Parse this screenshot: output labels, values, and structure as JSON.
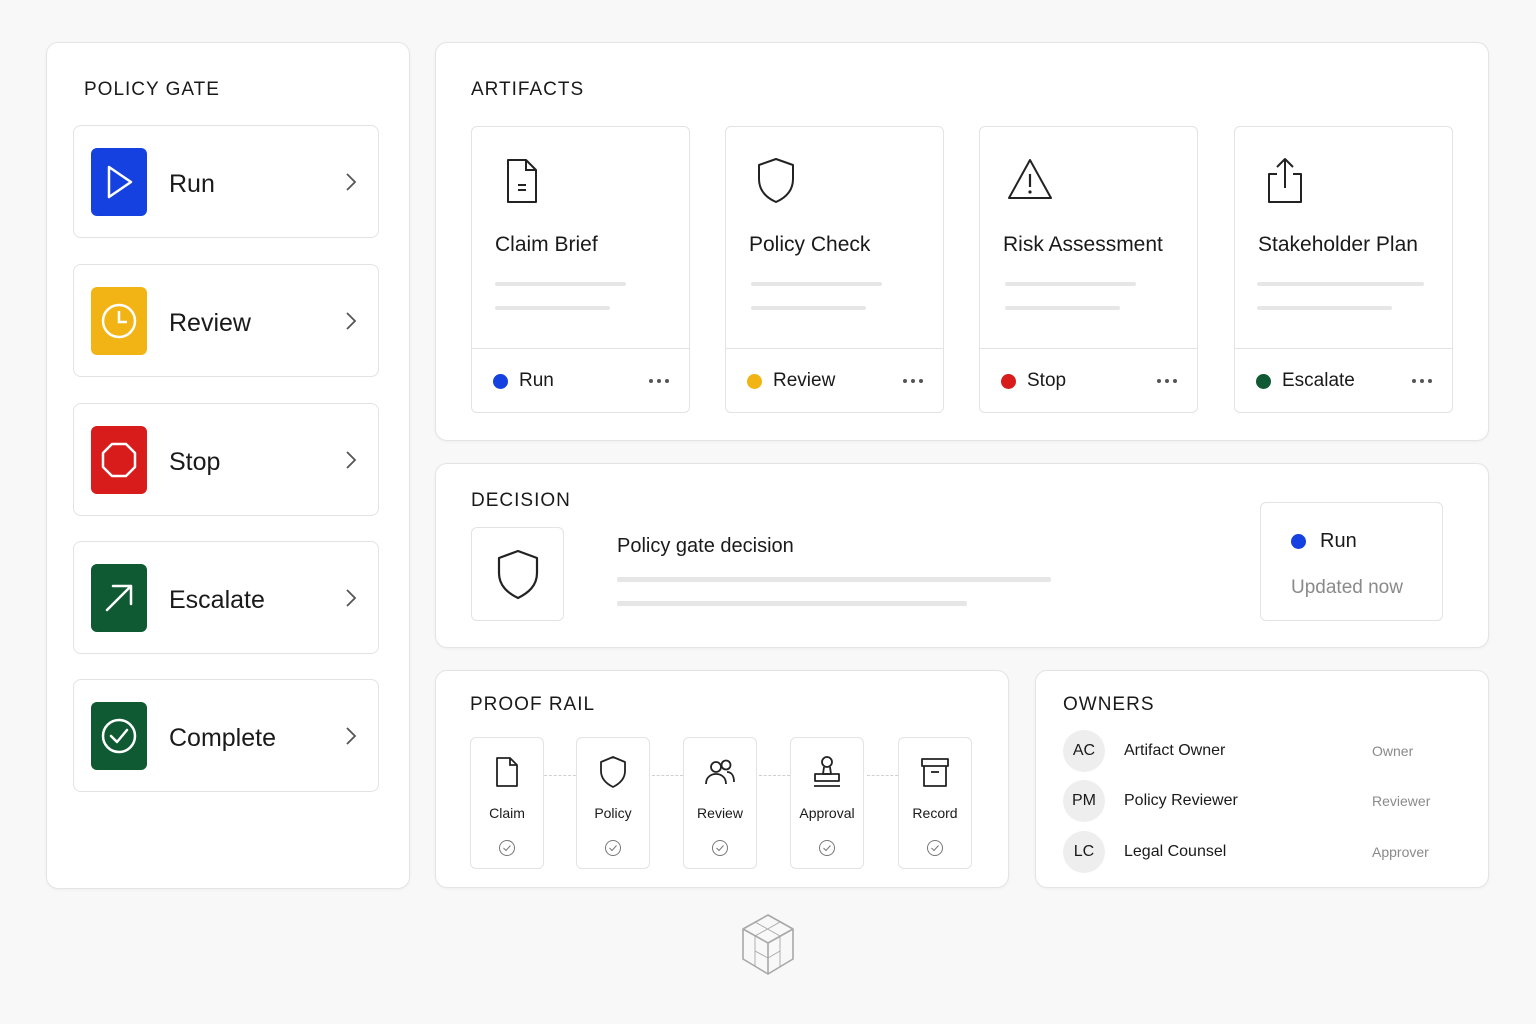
{
  "colors": {
    "run": "#1441e0",
    "review": "#f2b414",
    "stop": "#d81b1b",
    "escalate": "#0f5a32",
    "complete": "#0f5a32"
  },
  "policy_gate": {
    "title": "POLICY GATE",
    "items": [
      {
        "label": "Run",
        "icon": "play-icon"
      },
      {
        "label": "Review",
        "icon": "clock-icon"
      },
      {
        "label": "Stop",
        "icon": "octagon-icon"
      },
      {
        "label": "Escalate",
        "icon": "arrow-up-right-icon"
      },
      {
        "label": "Complete",
        "icon": "check-circle-icon"
      }
    ]
  },
  "artifacts": {
    "title": "ARTIFACTS",
    "cards": [
      {
        "name": "Claim Brief",
        "icon": "document-icon",
        "status": "Run"
      },
      {
        "name": "Policy Check",
        "icon": "shield-icon",
        "status": "Review"
      },
      {
        "name": "Risk Assessment",
        "icon": "warning-icon",
        "status": "Stop"
      },
      {
        "name": "Stakeholder Plan",
        "icon": "share-icon",
        "status": "Escalate"
      }
    ]
  },
  "decision": {
    "title": "DECISION",
    "heading": "Policy gate decision",
    "icon": "shield-icon",
    "status": "Run",
    "updated": "Updated now"
  },
  "proof_rail": {
    "title": "PROOF RAIL",
    "steps": [
      {
        "label": "Claim",
        "icon": "document-icon"
      },
      {
        "label": "Policy",
        "icon": "shield-icon"
      },
      {
        "label": "Review",
        "icon": "users-icon"
      },
      {
        "label": "Approval",
        "icon": "stamp-icon"
      },
      {
        "label": "Record",
        "icon": "archive-icon"
      }
    ]
  },
  "owners": {
    "title": "OWNERS",
    "rows": [
      {
        "initials": "AC",
        "name": "Artifact Owner",
        "role": "Owner"
      },
      {
        "initials": "PM",
        "name": "Policy Reviewer",
        "role": "Reviewer"
      },
      {
        "initials": "LC",
        "name": "Legal Counsel",
        "role": "Approver"
      }
    ]
  }
}
